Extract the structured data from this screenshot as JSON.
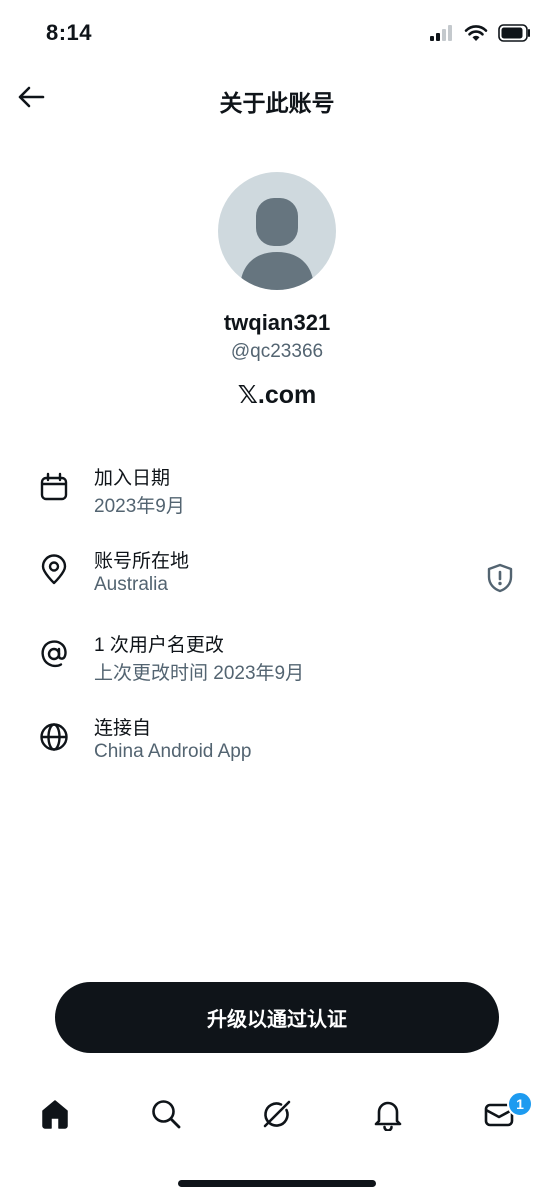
{
  "status_bar": {
    "time": "8:14"
  },
  "header": {
    "title": "关于此账号"
  },
  "profile": {
    "display_name": "twqian321",
    "handle": "@qc23366",
    "site": "𝕏.com"
  },
  "info_items": [
    {
      "title": "加入日期",
      "subtitle": "2023年9月",
      "icon": "calendar-icon"
    },
    {
      "title": "账号所在地",
      "subtitle": "Australia",
      "icon": "location-pin-icon",
      "extra_icon": "shield-warning-icon"
    },
    {
      "title": "1 次用户名更改",
      "subtitle": "上次更改时间 2023年9月",
      "icon": "at-sign-icon"
    },
    {
      "title": "连接自",
      "subtitle": "China Android App",
      "icon": "globe-icon"
    }
  ],
  "cta": {
    "label": "升级以通过认证"
  },
  "tab_bar": {
    "tabs": [
      "home-icon",
      "search-icon",
      "grok-icon",
      "bell-icon",
      "mail-icon"
    ],
    "mail_badge": "1"
  },
  "colors": {
    "primary_text": "#0f1419",
    "secondary_text": "#536471",
    "accent": "#1d9bf0",
    "avatar_bg": "#cfd9de"
  }
}
